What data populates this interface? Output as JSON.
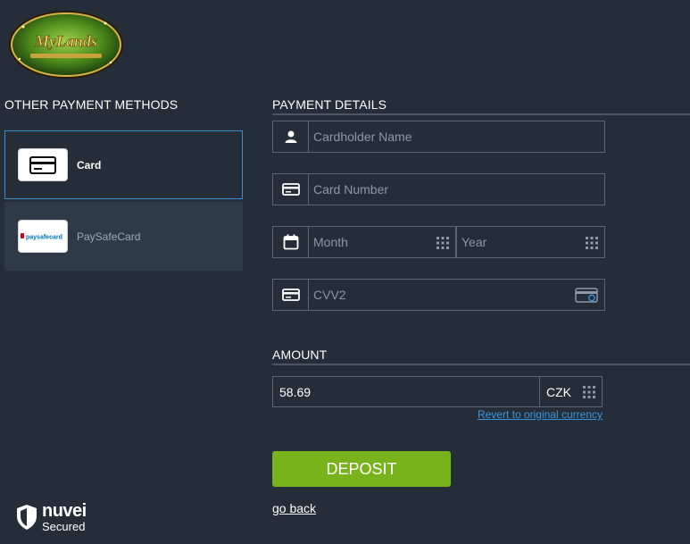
{
  "brand": {
    "logo_text": "MyLands"
  },
  "left": {
    "title": "OTHER PAYMENT METHODS",
    "methods": [
      {
        "label": "Card",
        "icon": "credit-card-icon",
        "selected": true
      },
      {
        "label": "PaySafeCard",
        "icon": "paysafecard-logo",
        "logo_text": "paysafecard",
        "selected": false
      }
    ]
  },
  "payment": {
    "title": "PAYMENT DETAILS",
    "cardholder_placeholder": "Cardholder Name",
    "card_number_placeholder": "Card Number",
    "month_placeholder": "Month",
    "year_placeholder": "Year",
    "cvv_placeholder": "CVV2"
  },
  "amount": {
    "title": "AMOUNT",
    "value": "58.69",
    "currency": "CZK",
    "revert_label": "Revert to original currency"
  },
  "actions": {
    "deposit_label": "DEPOSIT",
    "go_back_label": "go back"
  },
  "footer": {
    "provider": "nuvei",
    "provider_sub": "Secured"
  },
  "colors": {
    "background": "#242d38",
    "accent_green": "#79b31c",
    "link_blue": "#3a96e0",
    "selected_border": "#3a8fd0"
  }
}
